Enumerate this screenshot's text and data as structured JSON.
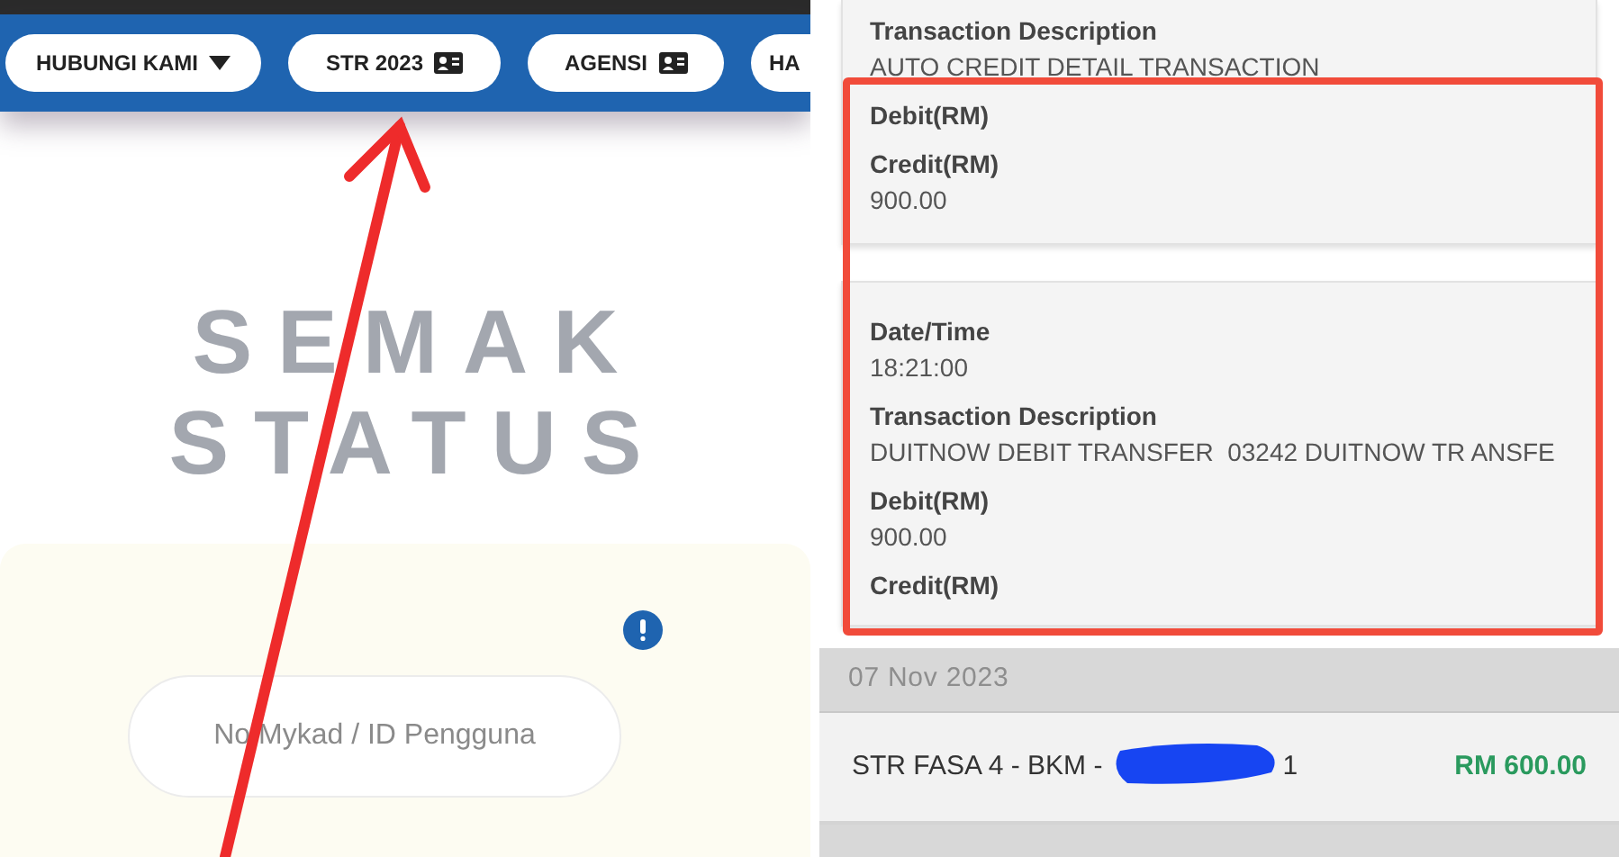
{
  "left_screen": {
    "nav_buttons": [
      {
        "label": "HUBUNGI KAMI",
        "kind": "dropdown"
      },
      {
        "label": "STR 2023",
        "kind": "card"
      },
      {
        "label": "AGENSI",
        "kind": "card"
      },
      {
        "label": "HA",
        "kind": "plain"
      }
    ],
    "heading_lines": [
      "SEMAK",
      "STATUS"
    ],
    "id_field": {
      "placeholder": "No Mykad / ID Pengguna"
    }
  },
  "right_screen": {
    "cards": [
      {
        "fields": [
          {
            "label": "Transaction Description",
            "value": "AUTO CREDIT DETAIL TRANSACTION"
          },
          {
            "label": "Debit(RM)"
          },
          {
            "label": "Credit(RM)",
            "value": "900.00"
          }
        ]
      },
      {
        "fields": [
          {
            "label": "Date/Time",
            "value": "18:21:00"
          },
          {
            "label": "Transaction Description",
            "value": "DUITNOW DEBIT TRANSFER  03242 DUITNOW TR ANSFE"
          },
          {
            "label": "Debit(RM)",
            "value": "900.00"
          },
          {
            "label": "Credit(RM)"
          }
        ]
      }
    ],
    "date_header": "07 Nov 2023",
    "transaction": {
      "description_start": "STR FASA 4 - BKM -",
      "description_end": "1",
      "amount": "RM 600.00"
    }
  }
}
